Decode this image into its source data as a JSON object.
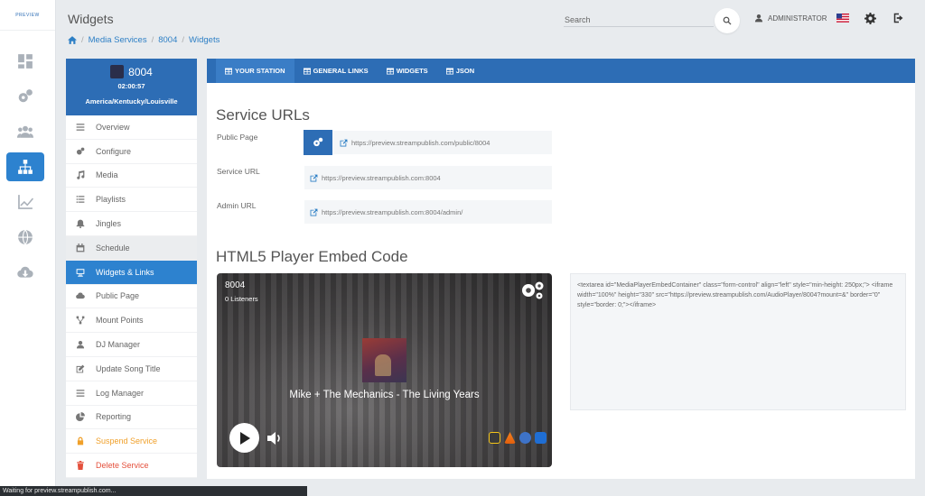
{
  "app": {
    "brand": "PREVIEW"
  },
  "rail": {
    "items": [
      {
        "icon": "dashboard-icon"
      },
      {
        "icon": "cogs-icon"
      },
      {
        "icon": "users-icon"
      },
      {
        "icon": "sitemap-icon",
        "active": true
      },
      {
        "icon": "line-chart-icon"
      },
      {
        "icon": "globe-icon"
      },
      {
        "icon": "cloud-download-icon"
      }
    ]
  },
  "header": {
    "title": "Widgets",
    "search_placeholder": "Search",
    "user": "ADMINISTRATOR"
  },
  "breadcrumb": {
    "items": [
      "Media Services",
      "8004",
      "Widgets"
    ]
  },
  "service": {
    "name": "8004",
    "time": "02:00:57",
    "timezone": "America/Kentucky/Louisville"
  },
  "menu": {
    "items": [
      {
        "label": "Overview",
        "icon": "list-icon"
      },
      {
        "label": "Configure",
        "icon": "cogs-icon"
      },
      {
        "label": "Media",
        "icon": "music-icon"
      },
      {
        "label": "Playlists",
        "icon": "list-icon"
      },
      {
        "label": "Jingles",
        "icon": "bell-icon"
      },
      {
        "label": "Schedule",
        "icon": "calendar-icon"
      },
      {
        "label": "Widgets & Links",
        "icon": "desktop-icon",
        "active": true
      },
      {
        "label": "Public Page",
        "icon": "cloud-icon"
      },
      {
        "label": "Mount Points",
        "icon": "sitemap-icon"
      },
      {
        "label": "DJ Manager",
        "icon": "user-icon"
      },
      {
        "label": "Update Song Title",
        "icon": "edit-icon"
      },
      {
        "label": "Log Manager",
        "icon": "list-icon"
      },
      {
        "label": "Reporting",
        "icon": "pie-chart-icon"
      },
      {
        "label": "Suspend Service",
        "icon": "lock-icon"
      },
      {
        "label": "Delete Service",
        "icon": "trash-icon"
      }
    ]
  },
  "tabs": [
    {
      "label": "YOUR STATION",
      "active": true
    },
    {
      "label": "GENERAL LINKS"
    },
    {
      "label": "WIDGETS"
    },
    {
      "label": "JSON"
    }
  ],
  "service_urls": {
    "title": "Service URLs",
    "public_page": {
      "label": "Public Page",
      "url": "https://preview.streampublish.com/public/8004"
    },
    "service_url": {
      "label": "Service URL",
      "url": "https://preview.streampublish.com:8004"
    },
    "admin_url": {
      "label": "Admin URL",
      "url": "https://preview.streampublish.com:8004/admin/"
    }
  },
  "embed": {
    "title": "HTML5 Player Embed Code",
    "code": "<textarea id=\"MediaPlayerEmbedContainer\" class=\"form-control\" align=\"left\" style=\"min-height: 250px;\"> <iframe width=\"100%\" height=\"330\" src=\"https://preview.streampublish.com/AudioPlayer/8004?mount=&\" border=\"0\" style=\"border: 0;\"></iframe>"
  },
  "player": {
    "station": "8004",
    "listeners": "0 Listeners",
    "song": "Mike + The Mechanics - The Living Years"
  },
  "status_bar": "Waiting for preview.streampublish.com...",
  "colors": {
    "primary": "#2d6db5",
    "active": "#2d82cf",
    "warning": "#f0a02a",
    "danger": "#e4503c"
  }
}
